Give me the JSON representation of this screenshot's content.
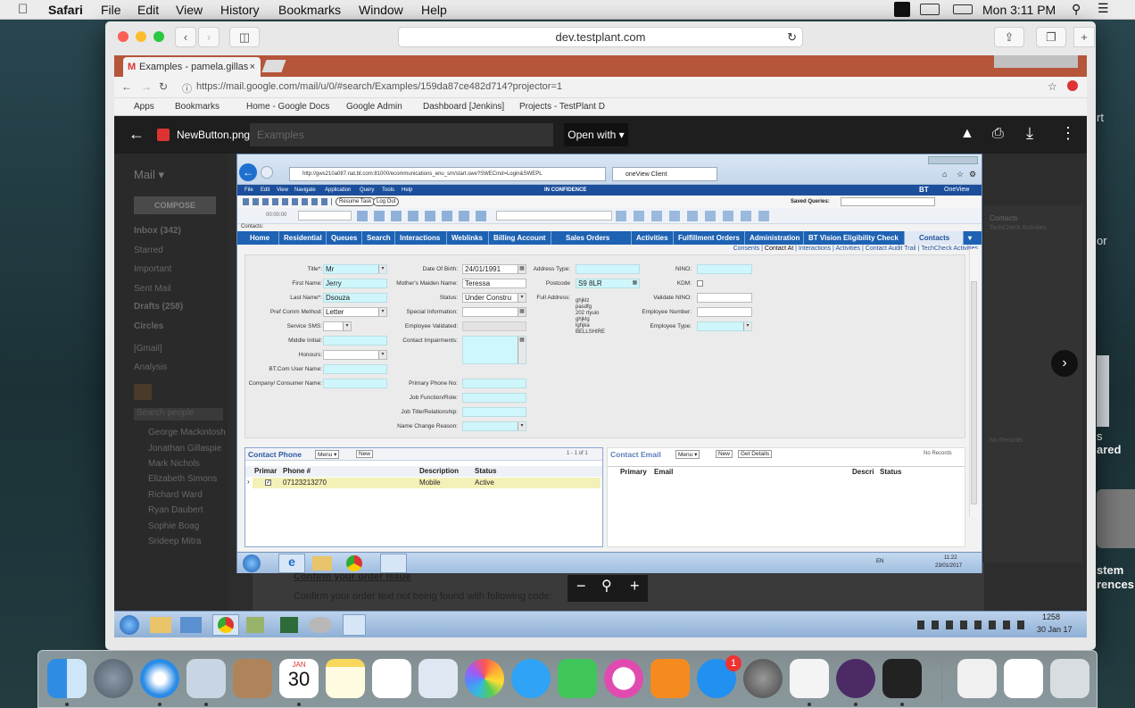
{
  "menubar": {
    "app": "Safari",
    "items": [
      "File",
      "Edit",
      "View",
      "History",
      "Bookmarks",
      "Window",
      "Help"
    ],
    "clock": "Mon 3:11 PM"
  },
  "safari": {
    "url": "dev.testplant.com"
  },
  "chrome": {
    "tab_title": "Examples - pamela.gillas",
    "address": "https://mail.google.com/mail/u/0/#search/Examples/159da87ce482d714?projector=1",
    "bookmarks": [
      "Apps",
      "Bookmarks",
      "Home - Google Docs",
      "Google Admin",
      "Dashboard [Jenkins]",
      "Projects - TestPlant D"
    ]
  },
  "gmail": {
    "mail_label": "Mail ▾",
    "compose": "COMPOSE",
    "nav": [
      "Inbox (342)",
      "Starred",
      "Important",
      "Sent Mail",
      "Drafts (258)",
      "Circles",
      "[Gmail]",
      "Analysis"
    ],
    "search_people": "Search people",
    "people": [
      "George Mackintosh",
      "Jonathan Gillaspie",
      "Mark Nichols",
      "Elizabeth Simons",
      "Richard Ward",
      "Ryan Daubert",
      "Sophie Boag",
      "Srideep Mitra"
    ],
    "search_text": "Examples",
    "bottom_link": "Confirm your order issue",
    "bottom_text": "Confirm your order text not being found with following code:",
    "right_contacts": "Contacts",
    "right_techcheck": "TechCheck Activities",
    "right_norecords": "No Records"
  },
  "viewer": {
    "filename": "NewButton.png",
    "open_with": "Open with"
  },
  "ie": {
    "address": "http://gws210a087.nat.bt.com:81000/ecommunications_enu_sm/start.swe?SWECmd=Login&SWEPL",
    "tab": "oneView Client"
  },
  "oneview": {
    "menu": [
      "File",
      "Edit",
      "View",
      "Navigate",
      "Application",
      "Query",
      "Tools",
      "Help"
    ],
    "confidence": "IN CONFIDENCE",
    "brand": "BT",
    "brand2": "OneView",
    "resume_task": "Resume Task",
    "log_out": "Log Out",
    "saved_queries": "Saved Queries:",
    "timer": "00:00:00",
    "contacts_label": "Contacts:",
    "tabs": [
      "Home",
      "Residential",
      "Queues",
      "Search",
      "Interactions",
      "Weblinks",
      "Billing Account",
      "Sales Orders",
      "Activities",
      "Fulfillment Orders",
      "Administration",
      "BT Vision Eligibility Check",
      "Contacts"
    ],
    "sublinks": [
      "Consents",
      "Contact At",
      "Interactions",
      "Activities",
      "Contact Audit Trail",
      "TechCheck Activities"
    ]
  },
  "form": {
    "col1": [
      {
        "label": "Title*:",
        "value": "Mr"
      },
      {
        "label": "First Name:",
        "value": "Jerry"
      },
      {
        "label": "Last Name*:",
        "value": "Dsouza"
      },
      {
        "label": "Pref Comm Method:",
        "value": "Letter"
      },
      {
        "label": "Service SMS:",
        "value": ""
      },
      {
        "label": "Middle Initial:",
        "value": ""
      },
      {
        "label": "Honours:",
        "value": ""
      },
      {
        "label": "BT.Com User Name:",
        "value": ""
      },
      {
        "label": "Company/ Consumer Name:",
        "value": ""
      }
    ],
    "col2": [
      {
        "label": "Date Of Birth:",
        "value": "24/01/1991"
      },
      {
        "label": "Mother's Maiden Name:",
        "value": "Teressa"
      },
      {
        "label": "Status:",
        "value": "Under Constru"
      },
      {
        "label": "Special Information:",
        "value": ""
      },
      {
        "label": "Employee Validated:",
        "value": ""
      },
      {
        "label": "Contact Impairments:",
        "value": ""
      },
      {
        "label": "Primary Phone No:",
        "value": ""
      },
      {
        "label": "Job Function/Role:",
        "value": ""
      },
      {
        "label": "Job Title/Relationship:",
        "value": ""
      },
      {
        "label": "Name Change Reason:",
        "value": ""
      }
    ],
    "col3": [
      {
        "label": "Address Type:",
        "value": ""
      },
      {
        "label": "Postcode",
        "value": "S9 8LR"
      },
      {
        "label": "Full Address:",
        "value": ""
      }
    ],
    "address_lines": [
      "ghjklz",
      "pasdfg",
      "202 rtyuio",
      "ghjklg",
      "lghjka",
      "BELLSHIRE"
    ],
    "col4": [
      {
        "label": "NINO:",
        "value": ""
      },
      {
        "label": "KDM:",
        "value": ""
      },
      {
        "label": "Validate NINO:",
        "value": ""
      },
      {
        "label": "Employee Number:",
        "value": ""
      },
      {
        "label": "Employee Type:",
        "value": ""
      }
    ]
  },
  "phone_panel": {
    "title": "Contact Phone",
    "menu": "Menu ▾",
    "new": "New",
    "count": "1 - 1 of 1",
    "headers": [
      "Primar",
      "Phone #",
      "Description",
      "Status"
    ],
    "row": {
      "phone": "07123213270",
      "description": "Mobile",
      "status": "Active"
    }
  },
  "email_panel": {
    "title": "Contact Email",
    "menu": "Menu ▾",
    "new": "New",
    "details": "Get Details",
    "norecords": "No Records",
    "headers": [
      "Primary",
      "Email",
      "Descri",
      "Status"
    ]
  },
  "win_taskbar": {
    "lang": "EN",
    "time": "11:22",
    "date": "23/01/2017"
  },
  "outer_taskbar": {
    "time": "1258",
    "date": "30 Jan 17"
  },
  "desktop_right": {
    "labels": [
      "rt",
      "or",
      "s",
      "ared",
      "stem",
      "rences"
    ]
  },
  "dock": {
    "calendar_month": "JAN",
    "calendar_day": "30",
    "appstore_badge": "1"
  }
}
